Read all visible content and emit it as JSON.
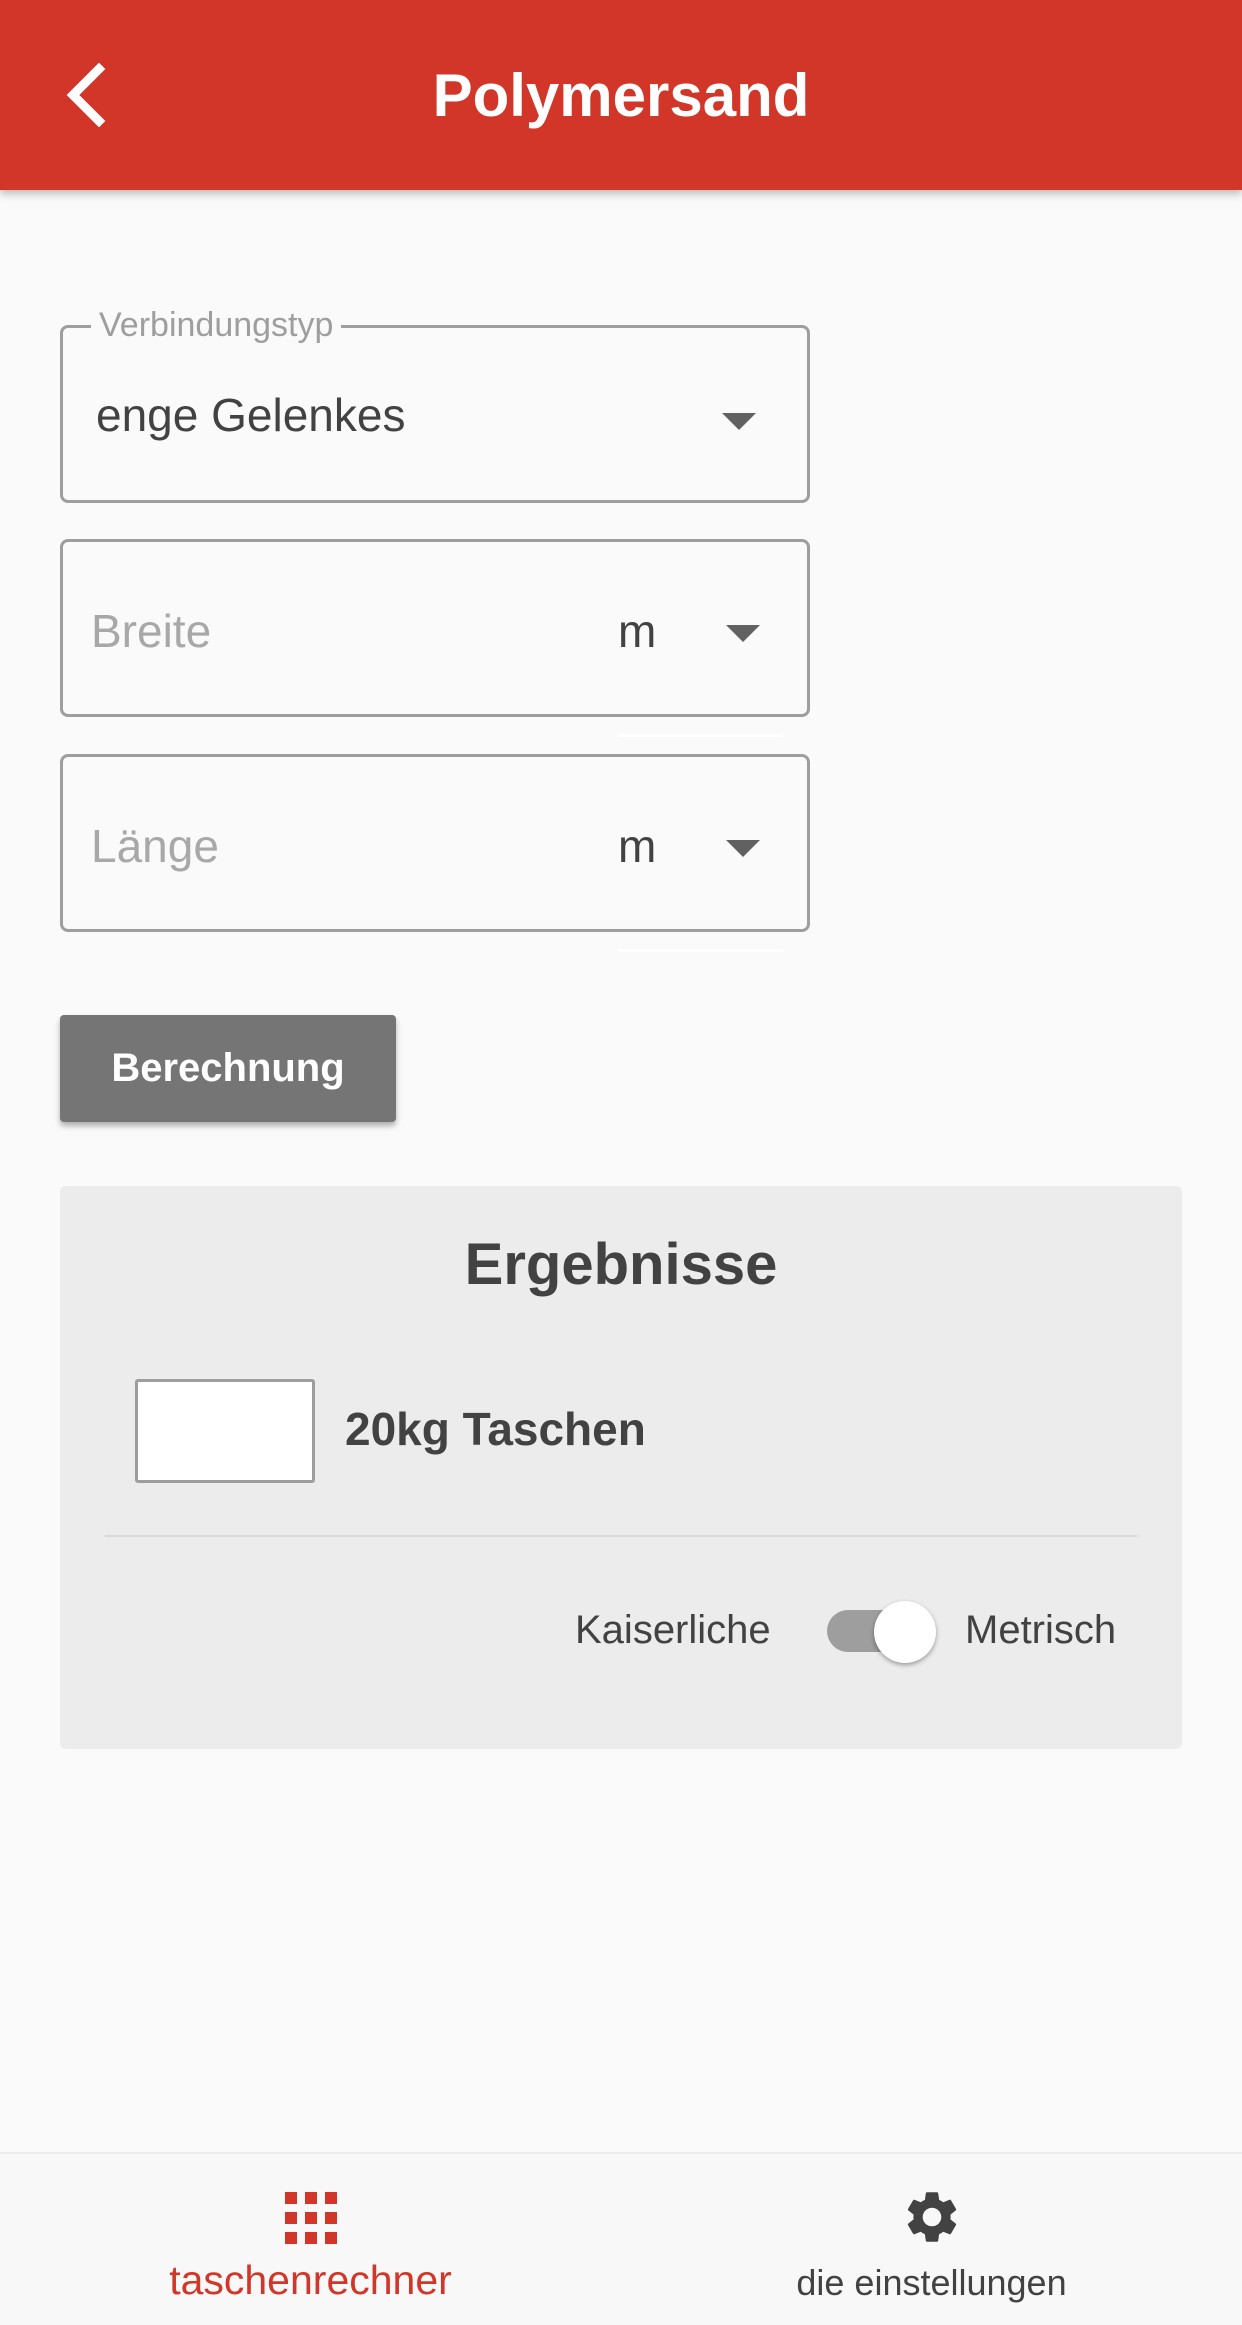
{
  "header": {
    "title": "Polymersand",
    "back_icon": "chevron-left-icon",
    "color": "#d13628"
  },
  "form": {
    "joint_type": {
      "label": "Verbindungstyp",
      "value": "enge Gelenkes"
    },
    "width": {
      "placeholder": "Breite",
      "unit": "m"
    },
    "length": {
      "placeholder": "Länge",
      "unit": "m"
    },
    "calculate_label": "Berechnung"
  },
  "results": {
    "title": "Ergebnisse",
    "bag_count": "",
    "bag_label": "20kg Taschen",
    "unit_imperial": "Kaiserliche",
    "unit_metric": "Metrisch",
    "metric_selected": true
  },
  "bottom_nav": {
    "items": [
      {
        "label": "taschenrechner",
        "icon": "grid-icon",
        "active": true,
        "color": "#d13628"
      },
      {
        "label": "die einstellungen",
        "icon": "gear-icon",
        "active": false,
        "color": "#424242"
      }
    ]
  }
}
